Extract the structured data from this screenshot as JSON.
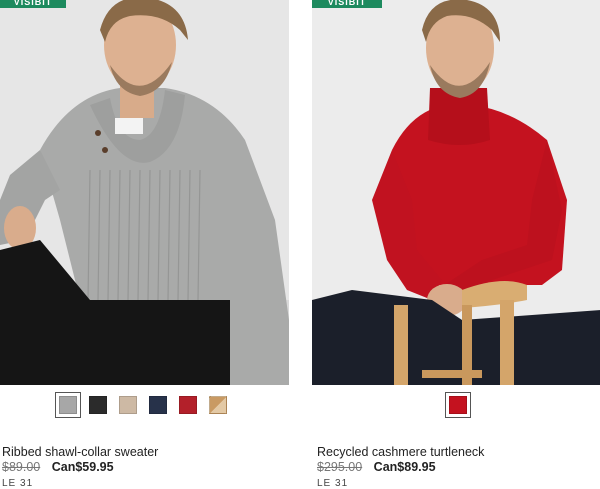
{
  "badge_text": "VISIBIT",
  "colors": {
    "badge_green": "#1d8a5e",
    "sweater_gray": "#a9aaa9",
    "turtleneck_red": "#c4121f"
  },
  "products": [
    {
      "title": "Ribbed shawl-collar sweater",
      "old_price": "$89.00",
      "new_price": "Can$59.95",
      "promo": "LE 31",
      "image_alt": "Model wearing grey ribbed shawl-collar sweater",
      "swatches": [
        {
          "name": "grey",
          "color": "#a7a7a7",
          "selected": true
        },
        {
          "name": "black",
          "color": "#2b2b2b",
          "selected": false
        },
        {
          "name": "beige",
          "color": "#cdb9a4",
          "selected": false
        },
        {
          "name": "navy",
          "color": "#27324a",
          "selected": false
        },
        {
          "name": "red",
          "color": "#b3202a",
          "selected": false
        },
        {
          "name": "camel",
          "color": "#c99a63",
          "selected": false
        }
      ]
    },
    {
      "title": "Recycled cashmere turtleneck",
      "old_price": "$295.00",
      "new_price": "Can$89.95",
      "promo": "LE 31",
      "image_alt": "Model wearing red recycled cashmere turtleneck",
      "swatches": [
        {
          "name": "red",
          "color": "#c4121f",
          "selected": true
        }
      ]
    }
  ]
}
